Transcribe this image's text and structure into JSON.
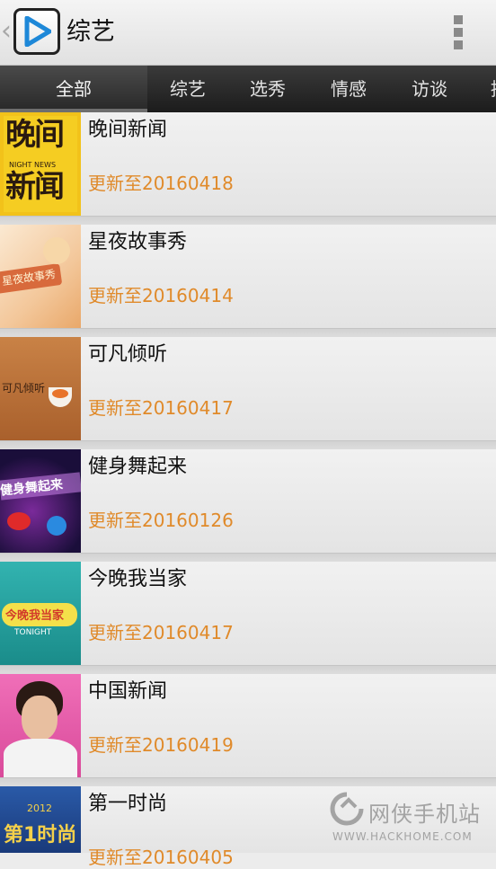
{
  "header": {
    "title": "综艺",
    "back_icon": "chevron-left-icon",
    "app_icon": "play-icon",
    "menu_icon": "overflow-menu-icon"
  },
  "tabs": [
    {
      "label": "全部",
      "active": true
    },
    {
      "label": "综艺"
    },
    {
      "label": "选秀"
    },
    {
      "label": "情感"
    },
    {
      "label": "访谈"
    },
    {
      "label": "搞"
    }
  ],
  "items": [
    {
      "title": "晚间新闻",
      "subtitle": "更新至20160418",
      "thumb_text": "晚间",
      "thumb_text2": "新闻",
      "thumb_small": "NIGHT NEWS"
    },
    {
      "title": "星夜故事秀",
      "subtitle": "更新至20160414",
      "thumb_text": "星夜故事秀"
    },
    {
      "title": "可凡倾听",
      "subtitle": "更新至20160417",
      "thumb_text": "可凡倾听"
    },
    {
      "title": "健身舞起来",
      "subtitle": "更新至20160126",
      "thumb_text": "健身舞起来"
    },
    {
      "title": "今晚我当家",
      "subtitle": "更新至20160417",
      "thumb_text": "今晚我当家",
      "thumb_small": "TONIGHT"
    },
    {
      "title": "中国新闻",
      "subtitle": "更新至20160419"
    },
    {
      "title": "第一时尚",
      "subtitle": "更新至20160405",
      "thumb_text": "第1时尚",
      "thumb_small": "2012"
    }
  ],
  "watermark": {
    "name": "网侠手机站",
    "url": "WWW.HACKHOME.COM"
  },
  "colors": {
    "accent": "#e08a2a",
    "tabbar": "#262626",
    "title": "#111111"
  }
}
